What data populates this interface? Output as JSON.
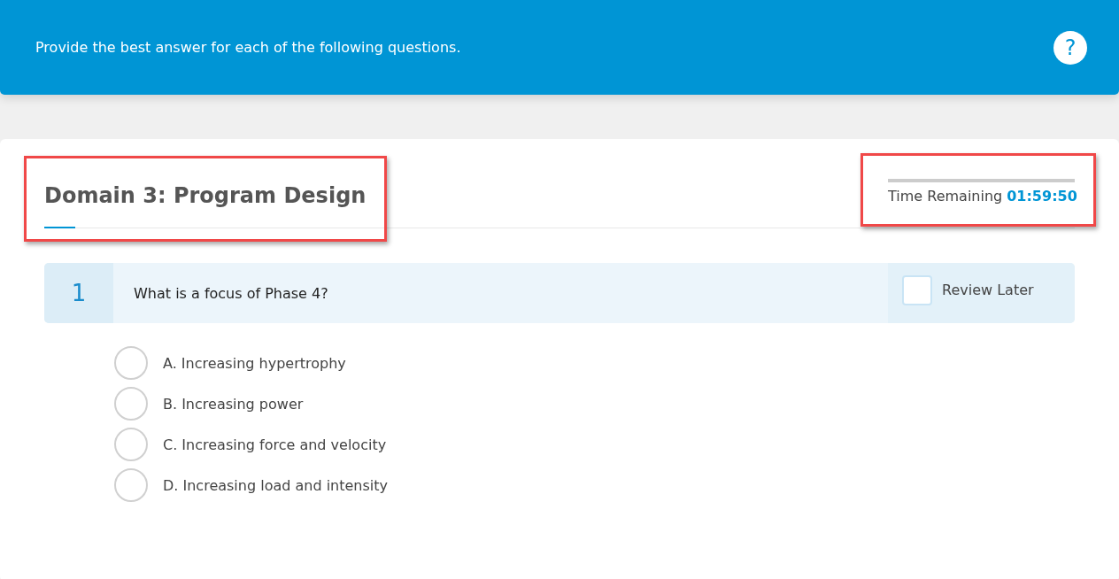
{
  "banner": {
    "instructions": "Provide the best answer for each of the following questions.",
    "help_icon": "?"
  },
  "section": {
    "title": "Domain 3: Program Design",
    "highlighted": true
  },
  "timer": {
    "label": "Time Remaining",
    "value": "01:59:50",
    "highlighted": true
  },
  "question": {
    "number": "1",
    "text": "What is a focus of Phase 4?",
    "review_later": {
      "label": "Review Later",
      "checked": false
    },
    "options": [
      {
        "label": "A. Increasing hypertrophy",
        "selected": false
      },
      {
        "label": "B. Increasing power",
        "selected": false
      },
      {
        "label": "C. Increasing force and velocity",
        "selected": false
      },
      {
        "label": "D. Increasing load and intensity",
        "selected": false
      }
    ]
  }
}
